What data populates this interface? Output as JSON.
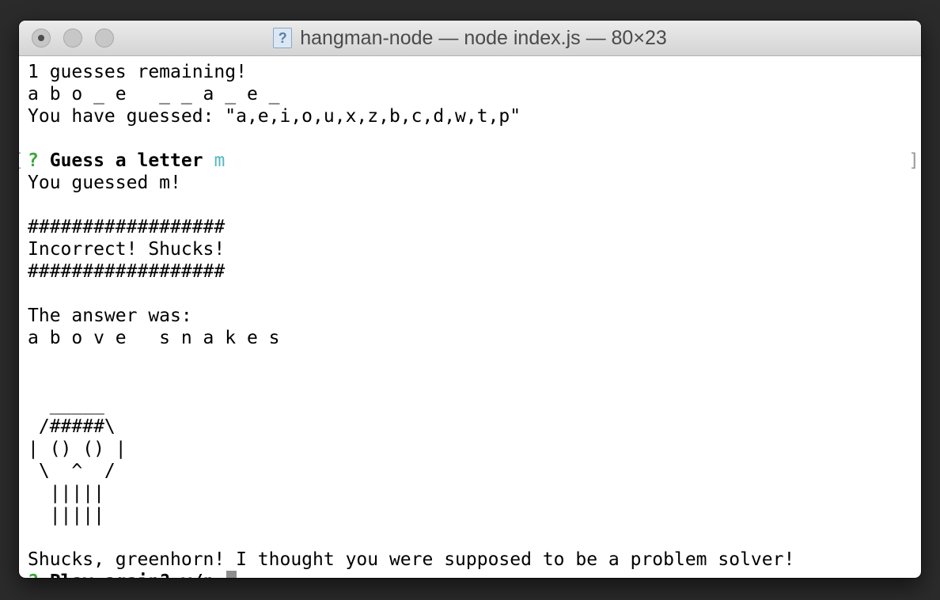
{
  "window": {
    "title": "hangman-node — node index.js — 80×23",
    "doc_icon_glyph": "?"
  },
  "terminal": {
    "lines": [
      "1 guesses remaining!",
      "a b o _ e   _ _ a _ e _",
      "You have guessed: \"a,e,i,o,u,x,z,b,c,d,w,t,p\"",
      "",
      "",
      "You guessed m!",
      "",
      "##################",
      "Incorrect! Shucks!",
      "##################",
      "",
      "The answer was:",
      "a b o v e   s n a k e s",
      "",
      "",
      "  _____",
      " /#####\\",
      "| () () |",
      " \\  ^  /",
      "  |||||",
      "  |||||",
      "",
      "Shucks, greenhorn! I thought you were supposed to be a problem solver!"
    ],
    "prompt1": {
      "bracket_left": "[",
      "mark": "?",
      "label": "Guess a letter",
      "answer": "m",
      "bracket_right": "]"
    },
    "prompt2": {
      "mark": "?",
      "label": "Play again? y/n"
    }
  }
}
